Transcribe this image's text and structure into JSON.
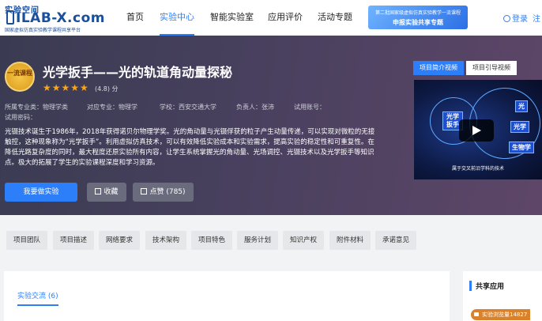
{
  "header": {
    "logo_top": "实验空间",
    "logo_main": "ILAB-X.com",
    "logo_sub": "国家虚拟仿真实验教学课程共享平台",
    "nav": [
      "首页",
      "实验中心",
      "智能实验室",
      "应用评价",
      "活动专题"
    ],
    "active_nav": "实验中心",
    "banner_line1": "第二批国家级虚拟仿真实验教学一流课程",
    "banner_line2": "申报实验共享专题",
    "login": "登录",
    "register": "注"
  },
  "hero": {
    "badge": "一流课程",
    "title": "光学扳手——光的轨道角动量探秘",
    "stars": "★★★★★",
    "rating": "(4.8) 分",
    "meta": {
      "subject": "所属专业类：物理学类",
      "major": "对应专业：物理学",
      "school": "学校：西安交通大学",
      "owner": "负责人：张沛",
      "account": "试用账号：",
      "password": "试用密码："
    },
    "description": "光镊技术诞生于1986年，2018年获得诺贝尔物理学奖。光的角动量与光镊俘获的粒子产生动量传递，可以实现对微粒的无接触控，这种现象称为“光学扳手”。利用虚拟仿真技术，可以有效降低实验成本和实验需求，提高实验的稳定性和可重复性。在降低光路复杂度的同时，最大程度还原实验所有内容，让学生系统掌握光的角动量、光场调控、光镊技术以及光学扳手等知识点。极大的拓展了学生的实验课程深度和学习资源。",
    "btn_experiment": "我要做实验",
    "btn_favorite": "收藏",
    "btn_like": "点赞 (785)"
  },
  "video": {
    "tab_intro": "项目简介视频",
    "tab_guide": "项目引导视频",
    "label_main": "光学 扳手",
    "label_a": "光",
    "label_b": "光学",
    "label_c": "生物学",
    "caption": "属于交叉前沿学科的技术"
  },
  "tabs": [
    "项目团队",
    "项目描述",
    "网络要求",
    "技术架构",
    "项目特色",
    "服务计划",
    "知识产权",
    "附件材料",
    "承诺意见"
  ],
  "content": {
    "tab_exchange": "实验交流 (6)",
    "share_title": "共享应用",
    "views": "实验浏览量14827"
  }
}
